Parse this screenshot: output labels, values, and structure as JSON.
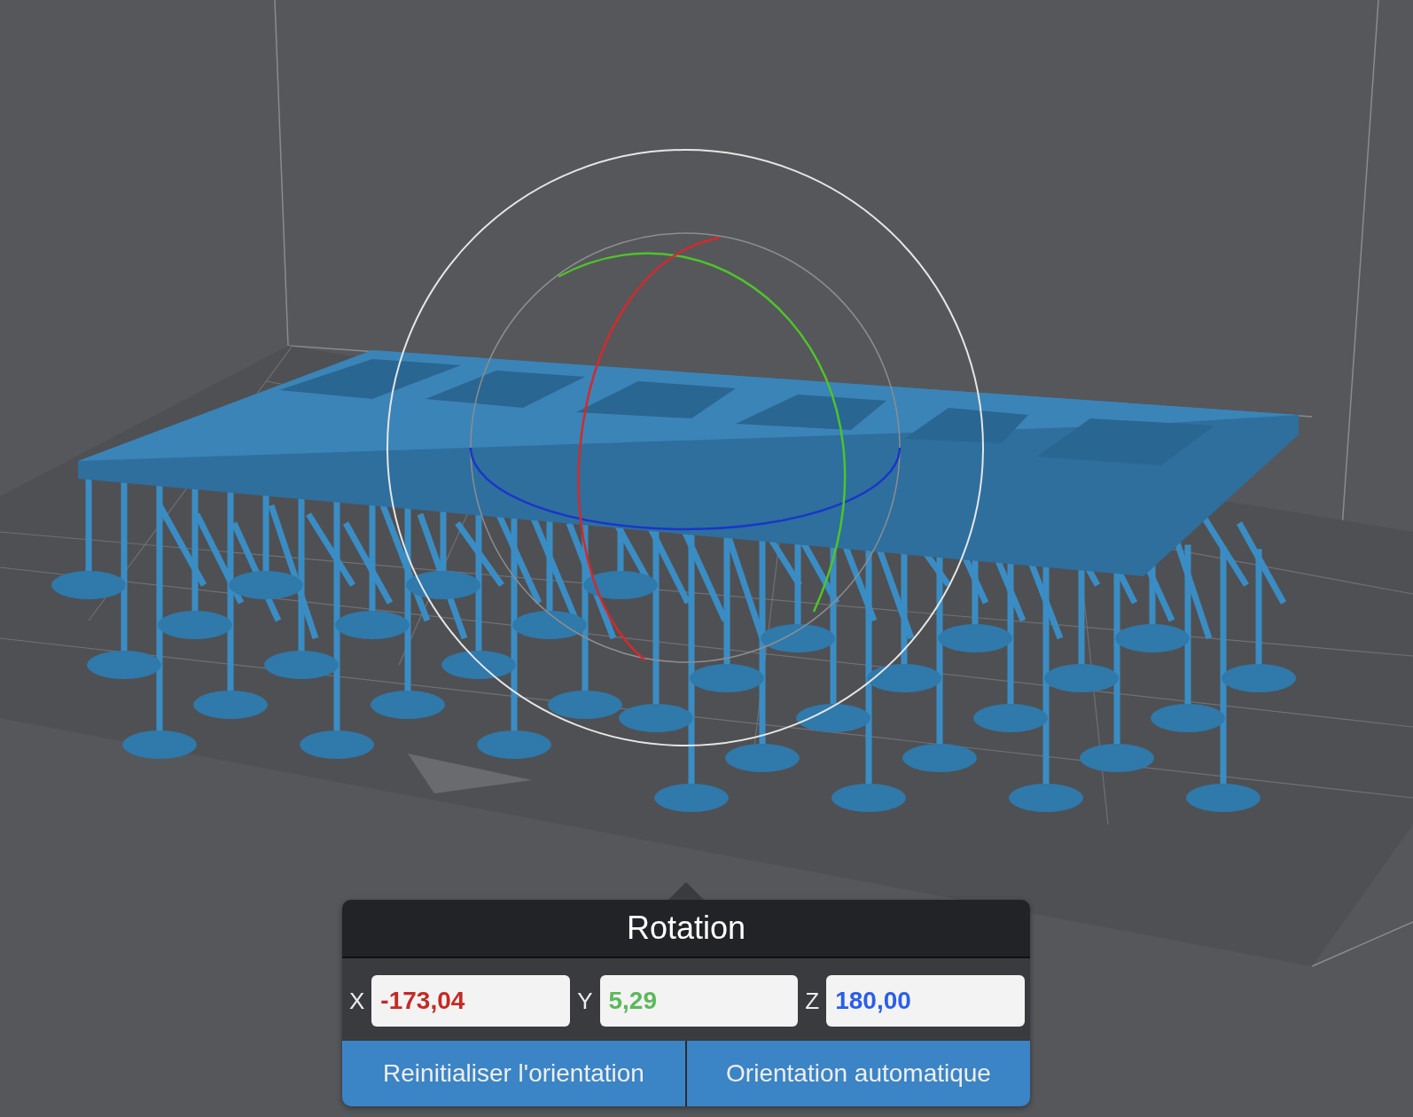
{
  "rotation_panel": {
    "title": "Rotation",
    "axes": [
      {
        "label": "X",
        "value": "-173,04",
        "color": "#c42a25"
      },
      {
        "label": "Y",
        "value": "5,29",
        "color": "#5cb85c"
      },
      {
        "label": "Z",
        "value": "180,00",
        "color": "#2b5ee8"
      }
    ],
    "buttons": [
      "Reinitialiser l'orientation",
      "Orientation automatique"
    ]
  }
}
